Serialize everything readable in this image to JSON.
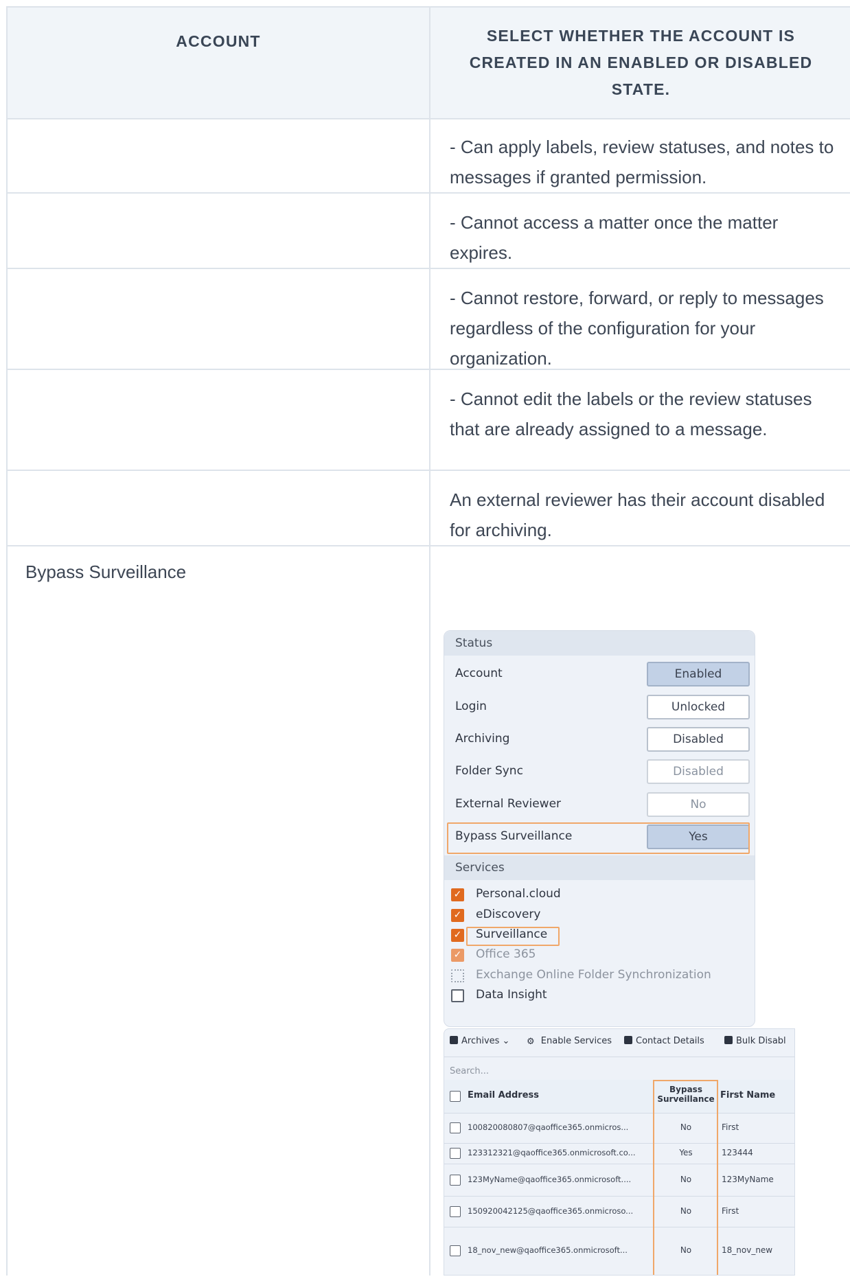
{
  "table": {
    "headers": {
      "account": "ACCOUNT",
      "state": "SELECT WHETHER THE ACCOUNT IS CREATED IN AN ENABLED OR DISABLED STATE."
    },
    "rows": [
      {
        "account": "",
        "state": "- Can apply labels, review statuses, and notes to messages if granted permission."
      },
      {
        "account": "",
        "state": "- Cannot access a matter once the matter expires."
      },
      {
        "account": "",
        "state": "- Cannot restore, forward, or reply to messages regardless of the configuration for your organization."
      },
      {
        "account": "",
        "state": "- Cannot edit the labels or the review statuses that are already assigned to a message."
      },
      {
        "account": "",
        "state": "An external reviewer has their account disabled for archiving."
      },
      {
        "account": "Bypass Surveillance",
        "state": ""
      }
    ]
  },
  "status_panel": {
    "status_heading": "Status",
    "rows": [
      {
        "label": "Account",
        "value": "Enabled"
      },
      {
        "label": "Login",
        "value": "Unlocked"
      },
      {
        "label": "Archiving",
        "value": "Disabled"
      },
      {
        "label": "Folder Sync",
        "value": "Disabled"
      },
      {
        "label": "External Reviewer",
        "value": "No"
      },
      {
        "label": "Bypass Surveillance",
        "value": "Yes"
      }
    ],
    "services_heading": "Services",
    "services": [
      {
        "label": "Personal.cloud",
        "checked": true
      },
      {
        "label": "eDiscovery",
        "checked": true
      },
      {
        "label": "Surveillance",
        "checked": true
      },
      {
        "label": "Office 365",
        "checked": true
      },
      {
        "label": "Exchange Online Folder Synchronization",
        "checked": false
      },
      {
        "label": "Data Insight",
        "checked": false
      }
    ],
    "highlight_color": "#f0a769",
    "checkbox_color": "#e06a1f"
  },
  "archives_list": {
    "toolbar": {
      "archives": "Archives ⌄",
      "enable_services": "Enable Services",
      "contact_details": "Contact Details",
      "bulk_disable": "Bulk Disabl"
    },
    "search_placeholder": "Search...",
    "columns": {
      "email": "Email Address",
      "bypass": "Bypass Surveillance",
      "first_name": "First Name"
    },
    "rows": [
      {
        "email": "100820080807@qaoffice365.onmicros...",
        "bypass": "No",
        "first_name": "First"
      },
      {
        "email": "123312321@qaoffice365.onmicrosoft.co...",
        "bypass": "Yes",
        "first_name": "123444"
      },
      {
        "email": "123MyName@qaoffice365.onmicrosoft....",
        "bypass": "No",
        "first_name": "123MyName"
      },
      {
        "email": "150920042125@qaoffice365.onmicroso...",
        "bypass": "No",
        "first_name": "First"
      },
      {
        "email": "18_nov_new@qaoffice365.onmicrosoft...",
        "bypass": "No",
        "first_name": "18_nov_new"
      }
    ]
  }
}
